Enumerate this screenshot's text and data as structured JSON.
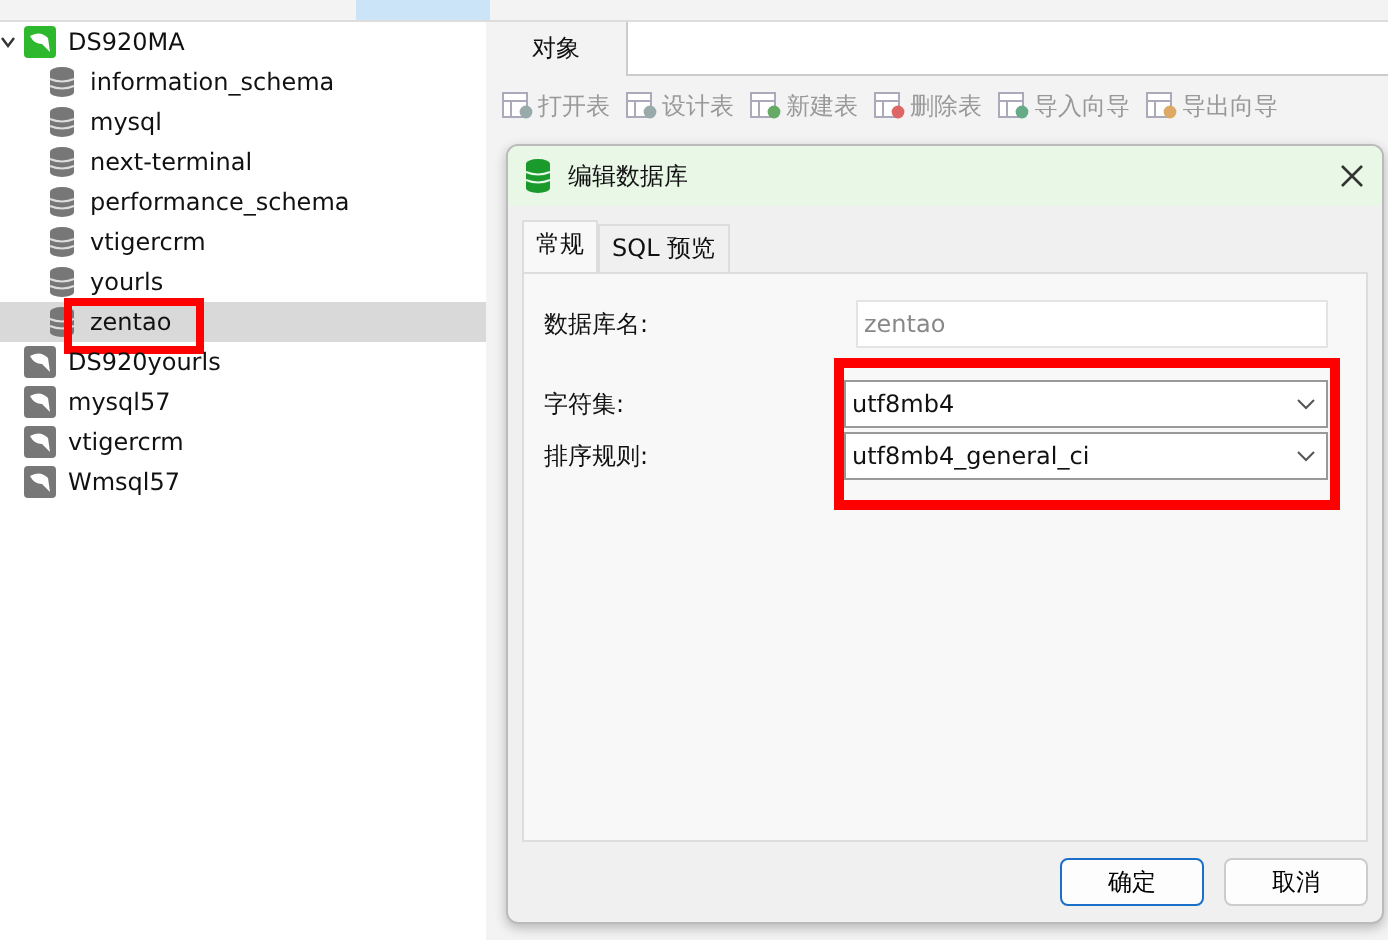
{
  "tree": [
    {
      "label": "DS920MA",
      "expanded": true,
      "children": [
        {
          "label": "information_schema",
          "selected": false
        },
        {
          "label": "mysql",
          "selected": false
        },
        {
          "label": "next-terminal",
          "selected": false
        },
        {
          "label": "performance_schema",
          "selected": false
        },
        {
          "label": "vtigercrm",
          "selected": false
        },
        {
          "label": "yourls",
          "selected": false
        },
        {
          "label": "zentao",
          "selected": true
        }
      ]
    },
    {
      "label": "DS920yourls",
      "expanded": false
    },
    {
      "label": "mysql57",
      "expanded": false
    },
    {
      "label": "vtigercrm",
      "expanded": false
    },
    {
      "label": "Wmsql57",
      "expanded": false
    }
  ],
  "object_tab": {
    "label": "对象"
  },
  "toolbar": [
    {
      "label": "打开表",
      "kind": "open",
      "disabled": true
    },
    {
      "label": "设计表",
      "kind": "design",
      "disabled": true
    },
    {
      "label": "新建表",
      "kind": "new",
      "disabled": true
    },
    {
      "label": "删除表",
      "kind": "delete",
      "disabled": true
    },
    {
      "label": "导入向导",
      "kind": "import",
      "disabled": true
    },
    {
      "label": "导出向导",
      "kind": "export",
      "disabled": true
    }
  ],
  "dialog": {
    "title": "编辑数据库",
    "tabs": [
      {
        "label": "常规",
        "selected": true
      },
      {
        "label": "SQL 预览",
        "selected": false
      }
    ],
    "fields": [
      {
        "label": "数据库名:",
        "kind": "text",
        "value": "zentao",
        "disabled": true
      },
      {
        "label": "字符集:",
        "kind": "select",
        "value": "utf8mb4",
        "disabled": false
      },
      {
        "label": "排序规则:",
        "kind": "select",
        "value": "utf8mb4_general_ci",
        "disabled": false
      }
    ],
    "buttons": [
      {
        "label": "确定",
        "primary": true
      },
      {
        "label": "取消",
        "primary": false
      }
    ]
  }
}
